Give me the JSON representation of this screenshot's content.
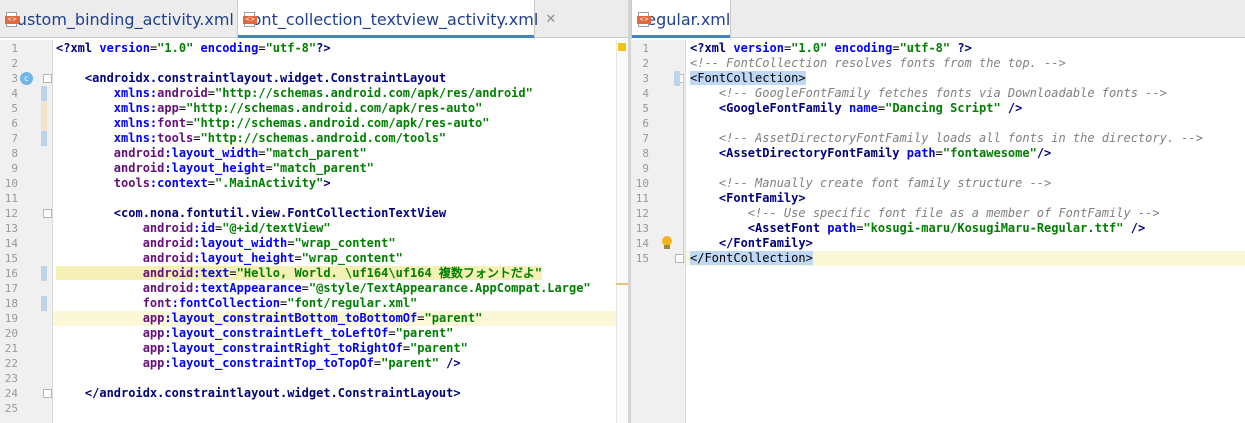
{
  "left_tabs": [
    {
      "label": "custom_binding_activity.xml",
      "close": "✕"
    },
    {
      "label": "font_collection_textview_activity.xml",
      "close": "✕"
    }
  ],
  "right_tabs": [
    {
      "label": "regular.xml"
    }
  ],
  "left_lines": [
    {
      "num": "1",
      "segments": [
        [
          "tag",
          "<?xml "
        ],
        [
          "attr",
          "version"
        ],
        [
          "eq",
          "="
        ],
        [
          "val",
          "\"1.0\""
        ],
        [
          "eq",
          " "
        ],
        [
          "attr",
          "encoding"
        ],
        [
          "eq",
          "="
        ],
        [
          "val",
          "\"utf-8\""
        ],
        [
          "tag",
          "?>"
        ]
      ]
    },
    {
      "num": "2",
      "segments": []
    },
    {
      "num": "3",
      "segments": [
        [
          "eq",
          "    "
        ],
        [
          "tag",
          "<androidx.constraintlayout.widget.ConstraintLayout"
        ]
      ]
    },
    {
      "num": "4",
      "segments": [
        [
          "eq",
          "        "
        ],
        [
          "attr",
          "xmlns:"
        ],
        [
          "ns",
          "android"
        ],
        [
          "eq",
          "="
        ],
        [
          "val",
          "\"http://schemas.android.com/apk/res/android\""
        ]
      ]
    },
    {
      "num": "5",
      "segments": [
        [
          "eq",
          "        "
        ],
        [
          "attr",
          "xmlns:"
        ],
        [
          "ns",
          "app"
        ],
        [
          "eq",
          "="
        ],
        [
          "val",
          "\"http://schemas.android.com/apk/res-auto\""
        ]
      ]
    },
    {
      "num": "6",
      "segments": [
        [
          "eq",
          "        "
        ],
        [
          "attr",
          "xmlns:"
        ],
        [
          "ns",
          "font"
        ],
        [
          "eq",
          "="
        ],
        [
          "val",
          "\"http://schemas.android.com/apk/res-auto\""
        ]
      ]
    },
    {
      "num": "7",
      "segments": [
        [
          "eq",
          "        "
        ],
        [
          "attr",
          "xmlns:"
        ],
        [
          "ns",
          "tools"
        ],
        [
          "eq",
          "="
        ],
        [
          "val",
          "\"http://schemas.android.com/tools\""
        ]
      ]
    },
    {
      "num": "8",
      "segments": [
        [
          "eq",
          "        "
        ],
        [
          "ns",
          "android"
        ],
        [
          "attr",
          ":layout_width"
        ],
        [
          "eq",
          "="
        ],
        [
          "val",
          "\"match_parent\""
        ]
      ]
    },
    {
      "num": "9",
      "segments": [
        [
          "eq",
          "        "
        ],
        [
          "ns",
          "android"
        ],
        [
          "attr",
          ":layout_height"
        ],
        [
          "eq",
          "="
        ],
        [
          "val",
          "\"match_parent\""
        ]
      ]
    },
    {
      "num": "10",
      "segments": [
        [
          "eq",
          "        "
        ],
        [
          "ns",
          "tools"
        ],
        [
          "attr",
          ":context"
        ],
        [
          "eq",
          "="
        ],
        [
          "val",
          "\".MainActivity\""
        ],
        [
          "tag",
          ">"
        ]
      ]
    },
    {
      "num": "11",
      "segments": []
    },
    {
      "num": "12",
      "segments": [
        [
          "eq",
          "        "
        ],
        [
          "tag",
          "<com.nona.fontutil.view.FontCollectionTextView"
        ]
      ]
    },
    {
      "num": "13",
      "segments": [
        [
          "eq",
          "            "
        ],
        [
          "ns",
          "android"
        ],
        [
          "attr",
          ":id"
        ],
        [
          "eq",
          "="
        ],
        [
          "val",
          "\"@+id/textView\""
        ]
      ]
    },
    {
      "num": "14",
      "segments": [
        [
          "eq",
          "            "
        ],
        [
          "ns",
          "android"
        ],
        [
          "attr",
          ":layout_width"
        ],
        [
          "eq",
          "="
        ],
        [
          "val",
          "\"wrap_content\""
        ]
      ]
    },
    {
      "num": "15",
      "segments": [
        [
          "eq",
          "            "
        ],
        [
          "ns",
          "android"
        ],
        [
          "attr",
          ":layout_height"
        ],
        [
          "eq",
          "="
        ],
        [
          "val",
          "\"wrap_content\""
        ]
      ]
    },
    {
      "num": "16",
      "segments": [
        [
          "eq",
          "            "
        ],
        [
          "ns",
          "android"
        ],
        [
          "attr",
          ":text"
        ],
        [
          "eq",
          "="
        ],
        [
          "val",
          "\"Hello, World. \\uf164\\uf164 複数フォントだよ\""
        ]
      ],
      "highlight": true
    },
    {
      "num": "17",
      "segments": [
        [
          "eq",
          "            "
        ],
        [
          "ns",
          "android"
        ],
        [
          "attr",
          ":textAppearance"
        ],
        [
          "eq",
          "="
        ],
        [
          "val",
          "\"@style/TextAppearance.AppCompat.Large\""
        ]
      ]
    },
    {
      "num": "18",
      "segments": [
        [
          "eq",
          "            "
        ],
        [
          "ns",
          "font"
        ],
        [
          "attr",
          ":fontCollection"
        ],
        [
          "eq",
          "="
        ],
        [
          "val",
          "\"font/regular.xml\""
        ]
      ]
    },
    {
      "num": "19",
      "segments": [
        [
          "eq",
          "            "
        ],
        [
          "ns",
          "app"
        ],
        [
          "attr",
          ":layout_constraintBottom_toBottomOf"
        ],
        [
          "eq",
          "="
        ],
        [
          "val",
          "\"parent\""
        ]
      ],
      "caret": true
    },
    {
      "num": "20",
      "segments": [
        [
          "eq",
          "            "
        ],
        [
          "ns",
          "app"
        ],
        [
          "attr",
          ":layout_constraintLeft_toLeftOf"
        ],
        [
          "eq",
          "="
        ],
        [
          "val",
          "\"parent\""
        ]
      ]
    },
    {
      "num": "21",
      "segments": [
        [
          "eq",
          "            "
        ],
        [
          "ns",
          "app"
        ],
        [
          "attr",
          ":layout_constraintRight_toRightOf"
        ],
        [
          "eq",
          "="
        ],
        [
          "val",
          "\"parent\""
        ]
      ]
    },
    {
      "num": "22",
      "segments": [
        [
          "eq",
          "            "
        ],
        [
          "ns",
          "app"
        ],
        [
          "attr",
          ":layout_constraintTop_toTopOf"
        ],
        [
          "eq",
          "="
        ],
        [
          "val",
          "\"parent\""
        ],
        [
          "eq",
          " "
        ],
        [
          "tag",
          "/>"
        ]
      ]
    },
    {
      "num": "23",
      "segments": []
    },
    {
      "num": "24",
      "segments": [
        [
          "eq",
          "    "
        ],
        [
          "tag",
          "</androidx.constraintlayout.widget.ConstraintLayout>"
        ]
      ]
    },
    {
      "num": "25",
      "segments": []
    }
  ],
  "right_lines": [
    {
      "num": "1",
      "segments": [
        [
          "tag",
          "<?xml "
        ],
        [
          "attr",
          "version"
        ],
        [
          "eq",
          "="
        ],
        [
          "val",
          "\"1.0\""
        ],
        [
          "eq",
          " "
        ],
        [
          "attr",
          "encoding"
        ],
        [
          "eq",
          "="
        ],
        [
          "val",
          "\"utf-8\""
        ],
        [
          "eq",
          " "
        ],
        [
          "tag",
          "?>"
        ]
      ]
    },
    {
      "num": "2",
      "segments": [
        [
          "cmt",
          "<!-- FontCollection resolves fonts from the top. -->"
        ]
      ]
    },
    {
      "num": "3",
      "segments": [
        [
          "tagsel",
          "<FontCollection>"
        ]
      ]
    },
    {
      "num": "4",
      "segments": [
        [
          "eq",
          "    "
        ],
        [
          "cmt",
          "<!-- GoogleFontFamily fetches fonts via Downloadable fonts -->"
        ]
      ]
    },
    {
      "num": "5",
      "segments": [
        [
          "eq",
          "    "
        ],
        [
          "tag",
          "<GoogleFontFamily "
        ],
        [
          "attr",
          "name"
        ],
        [
          "eq",
          "="
        ],
        [
          "val",
          "\"Dancing Script\""
        ],
        [
          "eq",
          " "
        ],
        [
          "tag",
          "/>"
        ]
      ]
    },
    {
      "num": "6",
      "segments": []
    },
    {
      "num": "7",
      "segments": [
        [
          "eq",
          "    "
        ],
        [
          "cmt",
          "<!-- AssetDirectoryFontFamily loads all fonts in the directory. -->"
        ]
      ]
    },
    {
      "num": "8",
      "segments": [
        [
          "eq",
          "    "
        ],
        [
          "tag",
          "<AssetDirectoryFontFamily "
        ],
        [
          "attr",
          "path"
        ],
        [
          "eq",
          "="
        ],
        [
          "val",
          "\"fontawesome\""
        ],
        [
          "tag",
          "/>"
        ]
      ]
    },
    {
      "num": "9",
      "segments": []
    },
    {
      "num": "10",
      "segments": [
        [
          "eq",
          "    "
        ],
        [
          "cmt",
          "<!-- Manually create font family structure -->"
        ]
      ]
    },
    {
      "num": "11",
      "segments": [
        [
          "eq",
          "    "
        ],
        [
          "tag",
          "<FontFamily>"
        ]
      ]
    },
    {
      "num": "12",
      "segments": [
        [
          "eq",
          "        "
        ],
        [
          "cmt",
          "<!-- Use specific font file as a member of FontFamily -->"
        ]
      ]
    },
    {
      "num": "13",
      "segments": [
        [
          "eq",
          "        "
        ],
        [
          "tag",
          "<AssetFont "
        ],
        [
          "attr",
          "path"
        ],
        [
          "eq",
          "="
        ],
        [
          "val",
          "\"kosugi-maru/KosugiMaru-Regular.ttf\""
        ],
        [
          "eq",
          " "
        ],
        [
          "tag",
          "/>"
        ]
      ]
    },
    {
      "num": "14",
      "segments": [
        [
          "eq",
          "    "
        ],
        [
          "tag",
          "</FontFamily>"
        ]
      ]
    },
    {
      "num": "15",
      "segments": [
        [
          "tagsel",
          "</FontCollection>"
        ]
      ],
      "caret": true
    }
  ],
  "icons": {
    "xml_file": "xml-file-icon",
    "close": "close-icon",
    "class_gutter": "class-gutter-icon",
    "intention_bulb": "intention-bulb-icon",
    "fold": "fold-icon"
  },
  "gutter_badge": "c",
  "colors": {
    "tag": "#000080",
    "attribute": "#0000ff",
    "namespace": "#660e7a",
    "value": "#008000",
    "comment": "#808080",
    "tab_accent": "#4083c9",
    "caret_line": "#fbf8d8"
  }
}
